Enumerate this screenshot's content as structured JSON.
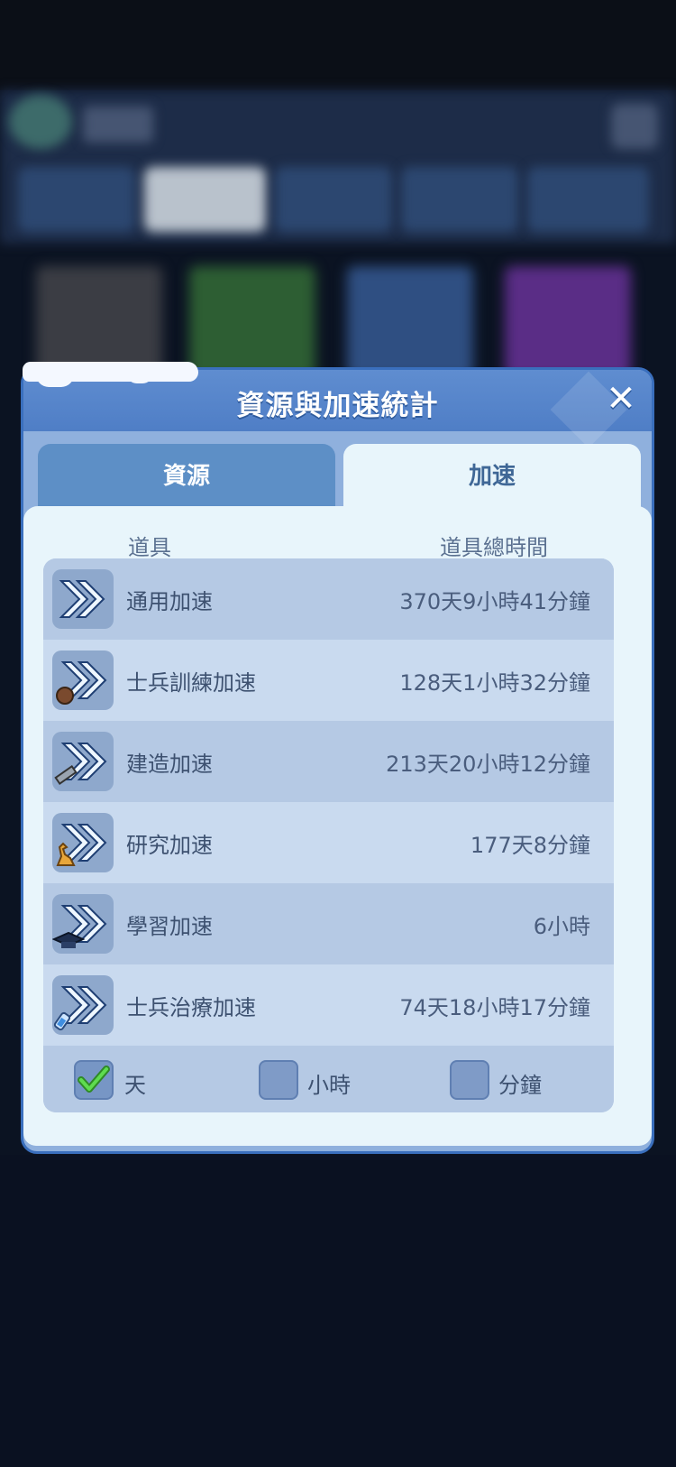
{
  "dialog": {
    "title": "資源與加速統計",
    "close_label": "✕"
  },
  "tabs": [
    {
      "label": "資源",
      "selected": false
    },
    {
      "label": "加速",
      "selected": true
    }
  ],
  "columns": {
    "items": "道具",
    "total_time": "道具總時間"
  },
  "rows": [
    {
      "label": "通用加速",
      "time": "370天9小時41分鐘",
      "icon": "general-speedup-icon"
    },
    {
      "label": "士兵訓練加速",
      "time": "128天1小時32分鐘",
      "icon": "training-speedup-icon"
    },
    {
      "label": "建造加速",
      "time": "213天20小時12分鐘",
      "icon": "construction-speedup-icon"
    },
    {
      "label": "研究加速",
      "time": "177天8分鐘",
      "icon": "research-speedup-icon"
    },
    {
      "label": "學習加速",
      "time": "6小時",
      "icon": "learning-speedup-icon"
    },
    {
      "label": "士兵治療加速",
      "time": "74天18小時17分鐘",
      "icon": "healing-speedup-icon"
    }
  ],
  "units": [
    {
      "label": "天",
      "checked": true
    },
    {
      "label": "小時",
      "checked": false
    },
    {
      "label": "分鐘",
      "checked": false
    }
  ],
  "colors": {
    "header": "#4f7ec6",
    "panel": "#e8f5fb",
    "row_dark": "#b5c9e4",
    "row_light": "#c9daef",
    "check_green": "#3fbf3a"
  }
}
